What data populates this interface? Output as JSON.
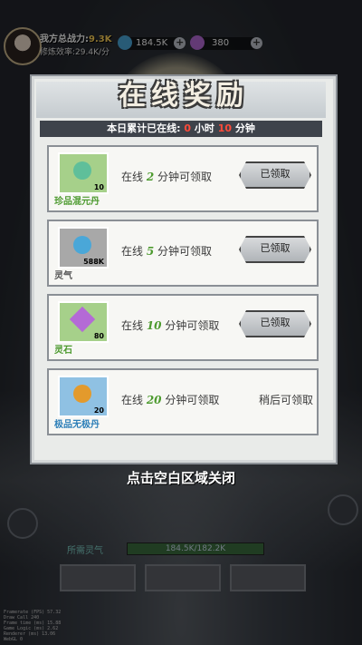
{
  "player": {
    "power_label": "我方总战力:",
    "power_value": "9.3K",
    "speed_text": "修炼效率:29.4K/分"
  },
  "resources": [
    {
      "name": "spirit-stone",
      "value": "184.5K",
      "icon_color": "#4aa7d8"
    },
    {
      "name": "gem",
      "value": "380",
      "icon_color": "#b46ad6"
    }
  ],
  "popup": {
    "title": "在线奖励",
    "online_prefix": "本日累计已在线: ",
    "hours": "0",
    "hours_unit": " 小时 ",
    "minutes": "10",
    "minutes_unit": " 分钟",
    "rewards": [
      {
        "name": "珍品混元丹",
        "count": "10",
        "cond_pre": "在线 ",
        "cond_num": "2",
        "cond_post": " 分钟可领取",
        "button": "已领取",
        "name_color": "#4c9a2e",
        "box_color": "#a6d08a",
        "gem_color": "#5fbf9a"
      },
      {
        "name": "灵气",
        "count": "588K",
        "cond_pre": "在线 ",
        "cond_num": "5",
        "cond_post": " 分钟可领取",
        "button": "已领取",
        "name_color": "#555555",
        "box_color": "#a8a8a8",
        "gem_color": "#4aa7d8"
      },
      {
        "name": "灵石",
        "count": "80",
        "cond_pre": "在线 ",
        "cond_num": "10",
        "cond_post": " 分钟可领取",
        "button": "已领取",
        "name_color": "#4c9a2e",
        "box_color": "#a6d08a",
        "gem_color": "#b46ad6"
      },
      {
        "name": "极品无极丹",
        "count": "20",
        "cond_pre": "在线 ",
        "cond_num": "20",
        "cond_post": " 分钟可领取",
        "status": "稍后可领取",
        "name_color": "#2d7fb8",
        "box_color": "#8fc1e3",
        "gem_color": "#e39a2c"
      }
    ],
    "close_hint": "点击空白区域关闭"
  },
  "bottom": {
    "need_label": "所需灵气",
    "need_value": "184.5K/182.2K"
  },
  "debug": [
    "Framerate (FPS)   57.32",
    "Draw Call           240",
    "Frame time (ms)   15.88",
    "Game Logic (ms)    2.62",
    "Renderer (ms)     13.06",
    "WebGL                 0"
  ]
}
